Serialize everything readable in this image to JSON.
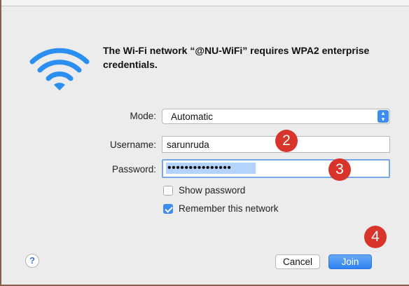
{
  "dialog": {
    "message": "The Wi-Fi network “@NU-WiFi” requires WPA2 enterprise credentials.",
    "icon": "wifi-icon"
  },
  "form": {
    "mode_label": "Mode:",
    "mode_value": "Automatic",
    "username_label": "Username:",
    "username_value": "sarunruda",
    "password_label": "Password:",
    "password_masked": "•••••••••••••••",
    "show_password_label": "Show password",
    "show_password_checked": false,
    "remember_label": "Remember this network",
    "remember_checked": true
  },
  "annotations": {
    "badge_2": "2",
    "badge_3": "3",
    "badge_4": "4",
    "color": "#d9342b"
  },
  "buttons": {
    "help": "?",
    "cancel": "Cancel",
    "join": "Join"
  },
  "colors": {
    "accent": "#3b8cf3",
    "selection": "#b4d3fb"
  }
}
